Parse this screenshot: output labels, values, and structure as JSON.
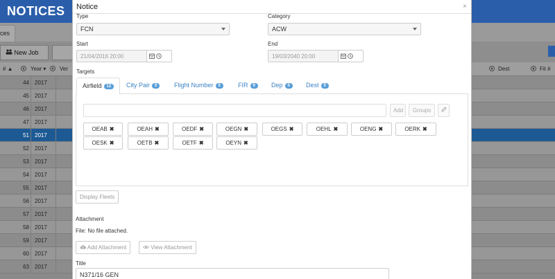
{
  "background": {
    "app_title": "NOTICES",
    "tab_label": "ces",
    "new_job_label": "New Job",
    "columns": [
      "# ▲",
      "Year ▾",
      "Ver",
      "Dest",
      "Fit #"
    ],
    "rows": [
      {
        "num": "44",
        "year": "2017"
      },
      {
        "num": "45",
        "year": "2017"
      },
      {
        "num": "46",
        "year": "2017"
      },
      {
        "num": "47",
        "year": "2017"
      },
      {
        "num": "51",
        "year": "2017"
      },
      {
        "num": "52",
        "year": "2017"
      },
      {
        "num": "53",
        "year": "2017"
      },
      {
        "num": "54",
        "year": "2017"
      },
      {
        "num": "55",
        "year": "2017"
      },
      {
        "num": "56",
        "year": "2017"
      },
      {
        "num": "57",
        "year": "2017"
      },
      {
        "num": "58",
        "year": "2017"
      },
      {
        "num": "59",
        "year": "2017"
      },
      {
        "num": "60",
        "year": "2017"
      },
      {
        "num": "63",
        "year": "2017"
      }
    ],
    "selected_row": "51"
  },
  "modal": {
    "title": "Notice",
    "close": "×",
    "type_label": "Type",
    "type_value": "FCN",
    "category_label": "Category",
    "category_value": "ACW",
    "start_label": "Start",
    "start_value": "21/04/2016 20:00",
    "end_label": "End",
    "end_value": "19/03/2040 20:00",
    "targets_label": "Targets",
    "tabs": [
      {
        "label": "Airfield",
        "count": "12"
      },
      {
        "label": "City Pair",
        "count": "0"
      },
      {
        "label": "Flight Number",
        "count": "0"
      },
      {
        "label": "FIR",
        "count": "0"
      },
      {
        "label": "Dep",
        "count": "0"
      },
      {
        "label": "Dest",
        "count": "0"
      }
    ],
    "add_label": "Add",
    "groups_label": "Groups",
    "airfields": [
      "OEAB",
      "OEAH",
      "OEDF",
      "OEGN",
      "OEGS",
      "OEHL",
      "OENG",
      "OERK",
      "OESK",
      "OETB",
      "OETF",
      "OEYN"
    ],
    "display_fleets_label": "Display Fleets",
    "attachment_label": "Attachment",
    "file_text": "File: No file attached.",
    "add_attachment_label": "Add Attachment",
    "view_attachment_label": "View Attachment",
    "title_label": "Title",
    "title_value": "N371/16 GEN"
  },
  "colors": {
    "header_blue": "#2b5eaa",
    "selected_row": "#1d5a94",
    "tab_link": "#3a82c4",
    "badge": "#5a9ed8"
  }
}
